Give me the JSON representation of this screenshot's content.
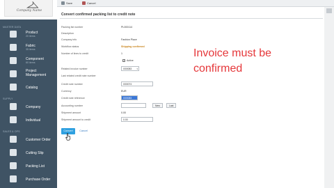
{
  "logo": {
    "company_name": "Company Name"
  },
  "sidebar": {
    "groups": [
      {
        "label": "MASTER DATA"
      },
      {
        "label": "SUPPLY"
      },
      {
        "label": "SALES & OPS"
      }
    ],
    "items": [
      {
        "title": "Product",
        "sub": "20 items",
        "icon": "shirt-icon"
      },
      {
        "title": "Fabric",
        "sub": "35 items",
        "icon": "fabric-icon"
      },
      {
        "title": "Component",
        "sub": "60 items",
        "icon": "component-icon"
      },
      {
        "title": "Project Management",
        "sub": "",
        "icon": "project-icon"
      },
      {
        "title": "Catalog",
        "sub": "",
        "icon": "catalog-icon"
      },
      {
        "title": "Company",
        "sub": "",
        "icon": "company-icon"
      },
      {
        "title": "Individual",
        "sub": "",
        "icon": "individual-icon"
      },
      {
        "title": "Customer Order",
        "sub": "",
        "icon": "customer-order-icon"
      },
      {
        "title": "Cutting Slip",
        "sub": "",
        "icon": "cutting-slip-icon"
      },
      {
        "title": "Packing List",
        "sub": "",
        "icon": "packing-list-icon"
      },
      {
        "title": "Purchase Order",
        "sub": "",
        "icon": "purchase-order-icon"
      }
    ]
  },
  "toolbar": {
    "save_label": "Save",
    "cancel_label": "Cancel"
  },
  "form": {
    "title": "Convert confirmed packing list to credit note",
    "fields": {
      "packing_list_number": {
        "label": "Packing list number",
        "value": "PL000114"
      },
      "description": {
        "label": "Description",
        "value": ""
      },
      "company_info": {
        "label": "Company info",
        "value": "Fashion Place"
      },
      "workflow_status": {
        "label": "Workflow status",
        "value": "Shipping confirmed"
      },
      "lines_to_credit": {
        "label": "Number of lines to credit",
        "value": "1"
      },
      "active": {
        "label": "",
        "checkbox_label": "Active",
        "checked": true
      },
      "related_invoice": {
        "label": "Related invoice number",
        "value": "I000083"
      },
      "last_related_credit_note": {
        "label": "Last related credit note number",
        "value": ""
      },
      "credit_note_number": {
        "label": "Credit note number",
        "value": "I000074"
      },
      "currency": {
        "label": "Currency",
        "value": "EUR"
      },
      "credit_note_reference": {
        "label": "Credit note reference",
        "value": "I000083"
      },
      "accounting_number": {
        "label": "Accounting number",
        "value": "",
        "new_label": "New",
        "last_label": "Last"
      },
      "shipment_amount": {
        "label": "Shipment amount",
        "value": "0.00"
      },
      "shipment_amount_to_credit": {
        "label": "Shipment amount to credit",
        "value": "0.00"
      }
    },
    "convert_label": "Convert",
    "cancel_label": "Cancel"
  },
  "annotation": {
    "text": "Invoice must be confirmed",
    "color": "#e5373a"
  }
}
